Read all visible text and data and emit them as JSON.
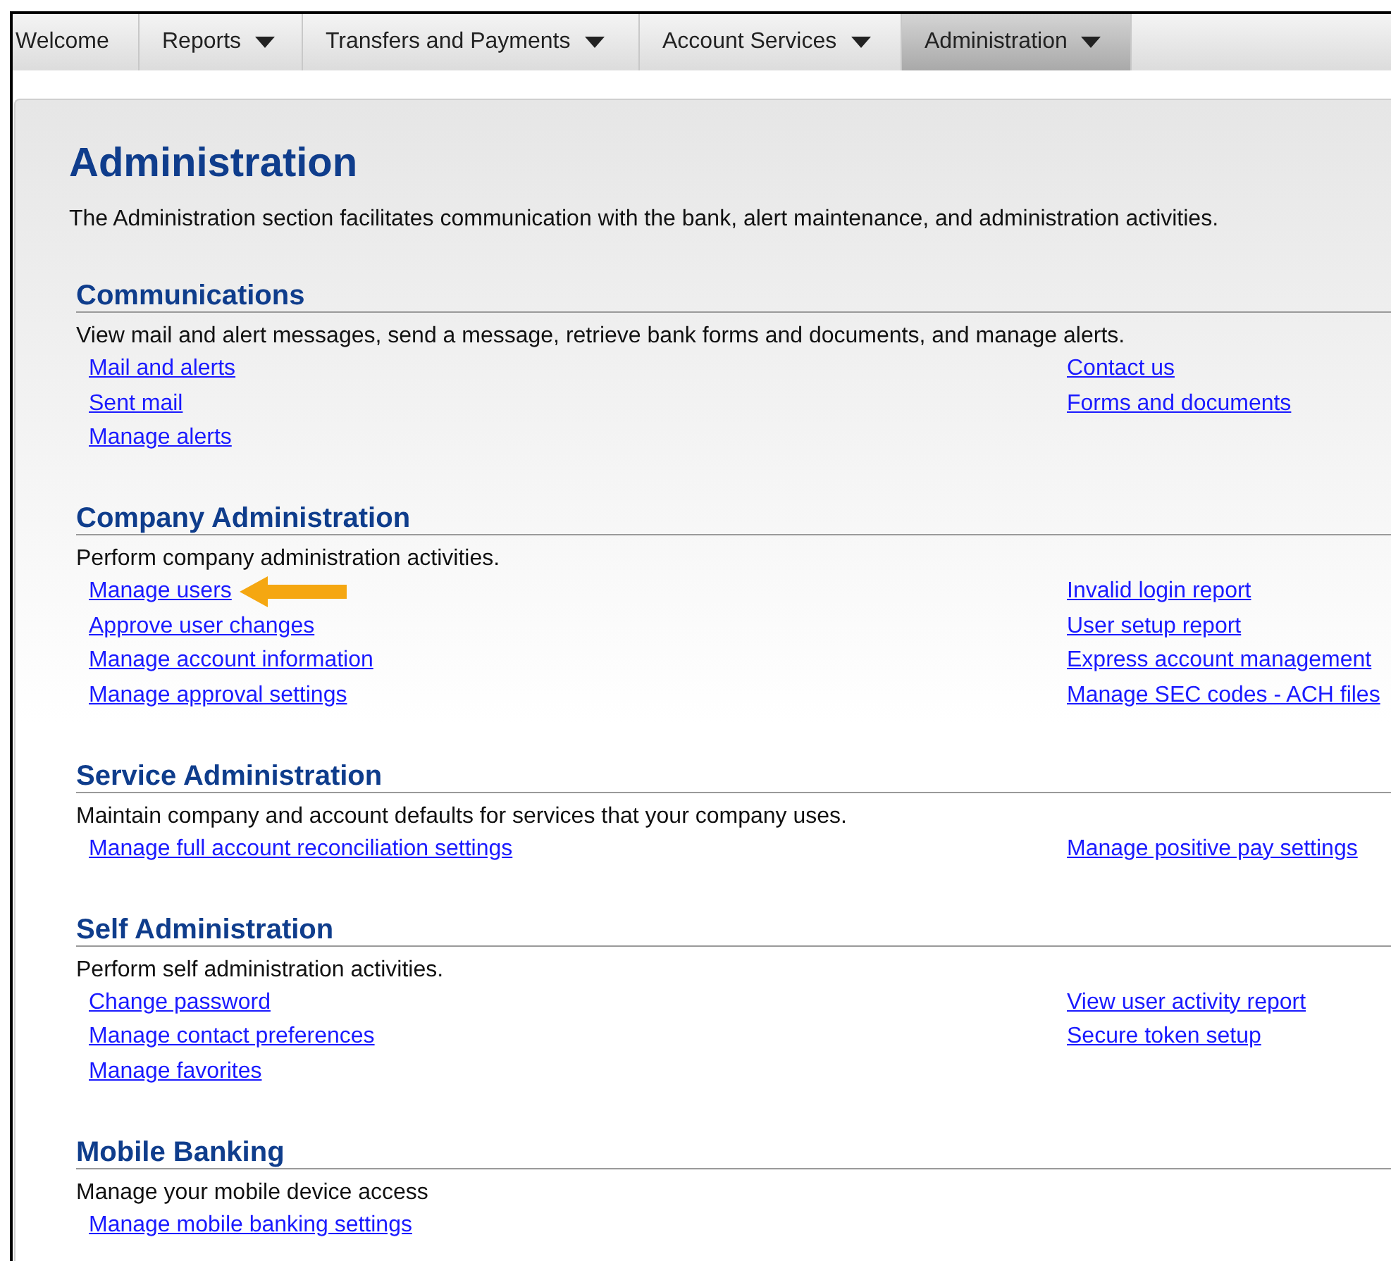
{
  "nav": {
    "tabs": [
      {
        "label": "Welcome",
        "dropdown": false,
        "selected": false
      },
      {
        "label": "Reports",
        "dropdown": true,
        "selected": false
      },
      {
        "label": "Transfers and Payments",
        "dropdown": true,
        "selected": false
      },
      {
        "label": "Account Services",
        "dropdown": true,
        "selected": false
      },
      {
        "label": "Administration",
        "dropdown": true,
        "selected": true
      }
    ]
  },
  "page": {
    "title": "Administration",
    "intro": "The Administration section facilitates communication with the bank, alert maintenance, and administration activities."
  },
  "sections": [
    {
      "title": "Communications",
      "description": "View mail and alert messages, send a message, retrieve bank forms and documents, and manage alerts.",
      "left_links": [
        {
          "label": "Mail and alerts",
          "pointer": false
        },
        {
          "label": "Sent mail",
          "pointer": false
        },
        {
          "label": "Manage alerts",
          "pointer": false
        }
      ],
      "right_links": [
        {
          "label": "Contact us",
          "pointer": false
        },
        {
          "label": "Forms and documents",
          "pointer": false
        }
      ]
    },
    {
      "title": "Company Administration",
      "description": "Perform company administration activities.",
      "left_links": [
        {
          "label": "Manage users",
          "pointer": true
        },
        {
          "label": "Approve user changes",
          "pointer": false
        },
        {
          "label": "Manage account information",
          "pointer": false
        },
        {
          "label": "Manage approval settings",
          "pointer": false
        }
      ],
      "right_links": [
        {
          "label": "Invalid login report",
          "pointer": false
        },
        {
          "label": "User setup report",
          "pointer": false
        },
        {
          "label": "Express account management",
          "pointer": false
        },
        {
          "label": "Manage SEC codes - ACH files",
          "pointer": false
        }
      ]
    },
    {
      "title": "Service Administration",
      "description": "Maintain company and account defaults for services that your company uses.",
      "left_links": [
        {
          "label": "Manage full account reconciliation settings",
          "pointer": false
        }
      ],
      "right_links": [
        {
          "label": "Manage positive pay settings",
          "pointer": false
        }
      ]
    },
    {
      "title": "Self Administration",
      "description": "Perform self administration activities.",
      "left_links": [
        {
          "label": "Change password",
          "pointer": false
        },
        {
          "label": "Manage contact preferences",
          "pointer": false
        },
        {
          "label": "Manage favorites",
          "pointer": false
        }
      ],
      "right_links": [
        {
          "label": "View user activity report",
          "pointer": false
        },
        {
          "label": "Secure token setup",
          "pointer": false
        }
      ]
    },
    {
      "title": "Mobile Banking",
      "description": "Manage your mobile device access",
      "left_links": [
        {
          "label": "Manage mobile banking settings",
          "pointer": false
        }
      ]
    }
  ]
}
